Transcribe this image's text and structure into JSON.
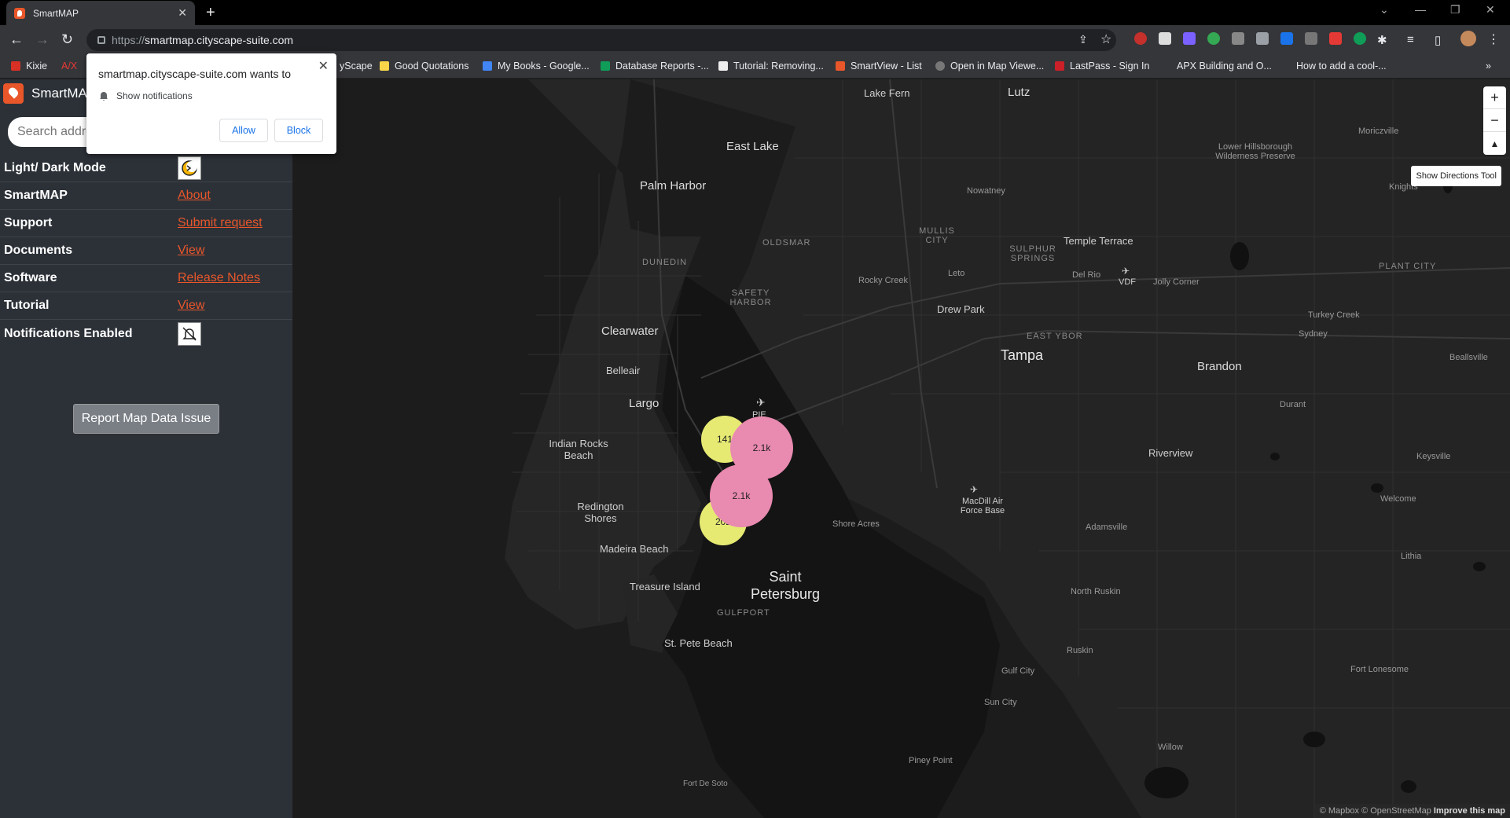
{
  "browser": {
    "tab_title": "SmartMAP",
    "url_scheme": "https://",
    "url_host": "smartmap.cityscape-suite.com",
    "bookmarks": [
      "Kixie",
      "A/X",
      "yScape",
      "Good Quotations",
      "My Books - Google...",
      "Database Reports -...",
      "Tutorial: Removing...",
      "SmartView - List",
      "Open in Map Viewe...",
      "LastPass - Sign In",
      "APX Building and O...",
      "How to add a cool-..."
    ]
  },
  "notification": {
    "title": "smartmap.cityscape-suite.com wants to",
    "permission": "Show notifications",
    "allow": "Allow",
    "block": "Block"
  },
  "sidebar": {
    "brand": "SmartMAP",
    "search_placeholder": "Search address",
    "rows": [
      {
        "label": "Light/ Dark Mode",
        "icon": "dark-mode-toggle-icon"
      },
      {
        "label": "SmartMAP",
        "link": "About"
      },
      {
        "label": "Support",
        "link": "Submit request"
      },
      {
        "label": "Documents",
        "link": "View"
      },
      {
        "label": "Software",
        "link": "Release Notes"
      },
      {
        "label": "Tutorial",
        "link": "View"
      },
      {
        "label": "Notifications Enabled",
        "icon": "bell-off-icon"
      }
    ],
    "report_button": "Report Map Data Issue"
  },
  "map": {
    "labels": [
      "Lake Fern",
      "Lutz",
      "East Lake",
      "Palm Harbor",
      "Nowatney",
      "Moriczville",
      "Lower Hillsborough Wilderness Preserve",
      "Knights",
      "DUNEDIN",
      "OLDSMAR",
      "MULLIS CITY",
      "SULPHUR SPRINGS",
      "Temple Terrace",
      "VDF",
      "Jolly Corner",
      "PLANT CITY",
      "SAFETY HARBOR",
      "Rocky Creek",
      "Leto",
      "Del Rio",
      "Turkey Creek",
      "Drew Park",
      "Sydney",
      "Clearwater",
      "EAST YBOR",
      "Tampa",
      "Brandon",
      "Beallsville",
      "Belleair",
      "Largo",
      "PIE",
      "Durant",
      "Indian Rocks Beach",
      "Riverview",
      "Keysville",
      "MacDill Air Force Base",
      "Redington Shores",
      "Shore Acres",
      "Welcome",
      "Adamsville",
      "Madeira Beach",
      "Lithia",
      "Saint Petersburg",
      "Treasure Island",
      "North Ruskin",
      "GULFPORT",
      "St. Pete Beach",
      "Ruskin",
      "Gulf City",
      "Fort Lonesome",
      "Sun City",
      "Willow",
      "Piney Point",
      "Fort De Soto"
    ],
    "clusters": [
      {
        "label": "141",
        "color": "#e6ea73"
      },
      {
        "label": "2.1k",
        "color": "#e98ab0"
      },
      {
        "label": "2.1k",
        "color": "#e98ab0"
      },
      {
        "label": "202",
        "color": "#e6ea73"
      }
    ],
    "zoom_in": "+",
    "zoom_out": "−",
    "compass": "▲",
    "directions_button": "Show Directions Tool",
    "attribution": "© Mapbox © OpenStreetMap",
    "improve": "Improve this map"
  }
}
